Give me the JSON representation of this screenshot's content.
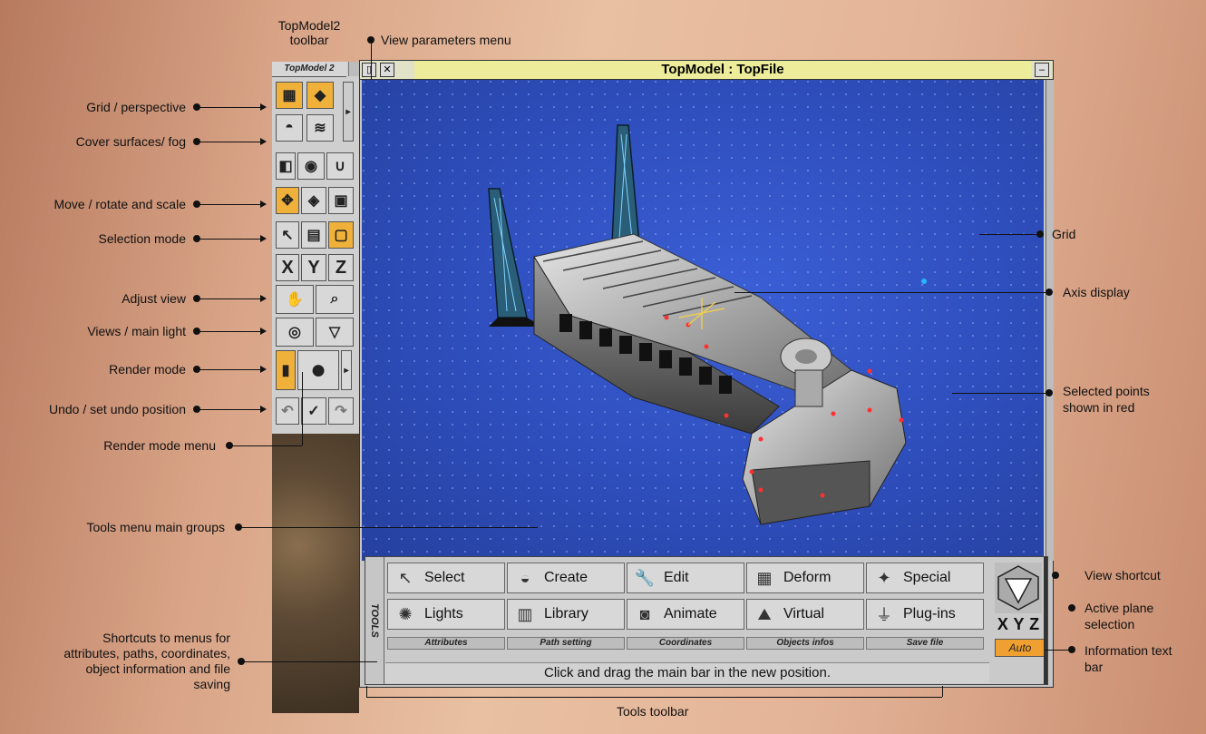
{
  "toolbar": {
    "title": "TopModel 2",
    "caption": "TopModel2 toolbar"
  },
  "window": {
    "title": "TopModel : TopFile"
  },
  "tools": {
    "side_label": "TOOLS",
    "row1": [
      "Select",
      "Create",
      "Edit",
      "Deform",
      "Special"
    ],
    "row2": [
      "Lights",
      "Library",
      "Animate",
      "Virtual",
      "Plug-ins"
    ],
    "shortcuts": [
      "Attributes",
      "Path setting",
      "Coordinates",
      "Objects infos",
      "Save file"
    ],
    "info_text": "Click and drag the main bar in the new position.",
    "xyz": [
      "X",
      "Y",
      "Z"
    ],
    "auto_label": "Auto"
  },
  "callouts_left": {
    "grid_perspective": "Grid / perspective",
    "cover_fog": "Cover surfaces/ fog",
    "move_rotate_scale": "Move / rotate and scale",
    "selection_mode": "Selection mode",
    "adjust_view": "Adjust view",
    "views_light": "Views / main light",
    "render_mode": "Render mode",
    "undo": "Undo / set undo position",
    "render_mode_menu": "Render mode menu",
    "tools_groups": "Tools menu main groups",
    "shortcuts_1": "Shortcuts to menus for",
    "shortcuts_2": "attributes, paths, coordinates,",
    "shortcuts_3": "object information and file",
    "shortcuts_4": "saving"
  },
  "callouts_top": {
    "view_params": "View parameters menu"
  },
  "callouts_right": {
    "grid": "Grid",
    "axis_display": "Axis display",
    "selected_1": "Selected points",
    "selected_2": "shown in red",
    "view_shortcut": "View shortcut",
    "active_plane_1": "Active plane",
    "active_plane_2": "selection",
    "info_bar_1": "Information text",
    "info_bar_2": "bar"
  },
  "callouts_bottom": {
    "tools_toolbar": "Tools toolbar"
  }
}
